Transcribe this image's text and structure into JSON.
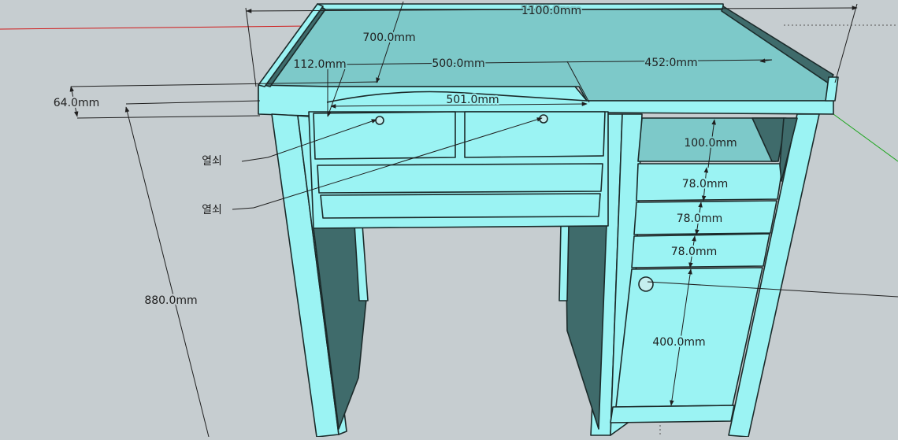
{
  "colors": {
    "background": "#c6cdd0",
    "body_cyan": "#9bf3f3",
    "top_surface": "#7dc9c9",
    "shadow_teal": "#3f6b6b",
    "edge": "#1b2a2a",
    "axis_red": "#d01818",
    "axis_green": "#19a51a"
  },
  "dimensions": {
    "width_total": "1100.0mm",
    "depth": "700.0mm",
    "left_offset": "112.0mm",
    "center_span": "500.0mm",
    "right_span": "452.0mm",
    "curve_width": "501.0mm",
    "top_thickness": "64.0mm",
    "height_total": "880.0mm",
    "upper_space": "100.0mm",
    "drawer_1": "78.0mm",
    "drawer_2": "78.0mm",
    "drawer_3": "78.0mm",
    "door": "400.0mm"
  },
  "callouts": {
    "key_top": "열쇠",
    "key_bottom": "열쇠"
  }
}
